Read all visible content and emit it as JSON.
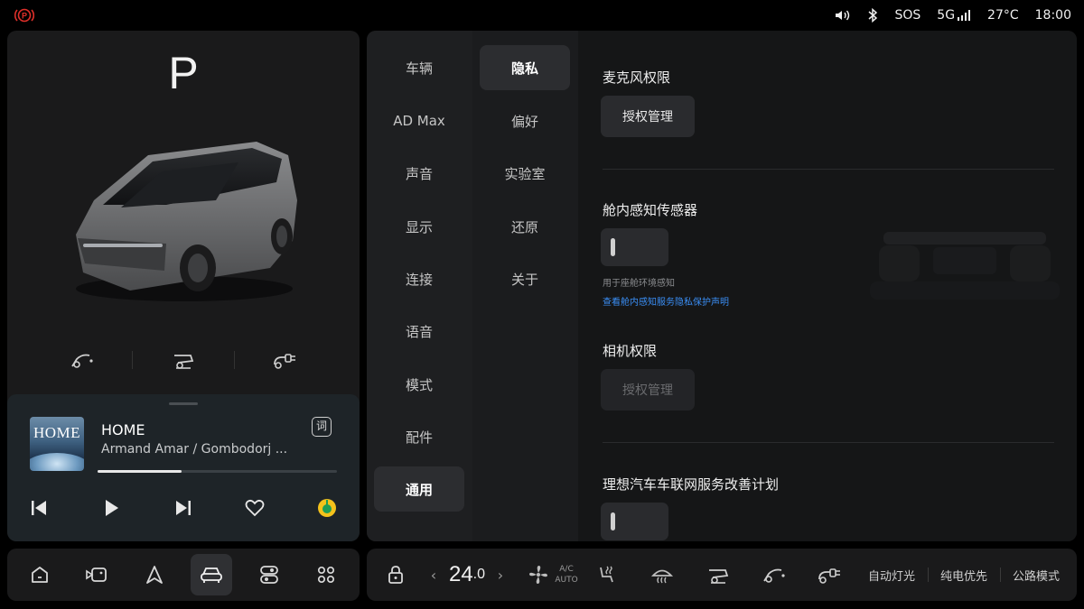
{
  "status_bar": {
    "park_icon": "parking-brake-icon",
    "sound_icon": "volume-icon",
    "bluetooth_icon": "bluetooth-icon",
    "sos": "SOS",
    "network": "5G",
    "temperature": "27°C",
    "time": "18:00"
  },
  "vehicle": {
    "gear": "P",
    "actions": [
      "front-trunk-icon",
      "rear-trunk-icon",
      "charge-port-icon"
    ]
  },
  "media": {
    "album_art_text": "HOME",
    "title": "HOME",
    "artist": "Armand Amar / Gombodorj ...",
    "lyrics_label": "词",
    "progress": 0.35
  },
  "settings": {
    "primary_nav": [
      {
        "label": "车辆"
      },
      {
        "label": "AD Max"
      },
      {
        "label": "声音"
      },
      {
        "label": "显示"
      },
      {
        "label": "连接"
      },
      {
        "label": "语音"
      },
      {
        "label": "模式"
      },
      {
        "label": "配件"
      },
      {
        "label": "通用",
        "active": true
      }
    ],
    "secondary_nav": [
      {
        "label": "隐私",
        "active": true
      },
      {
        "label": "偏好"
      },
      {
        "label": "实验室"
      },
      {
        "label": "还原"
      },
      {
        "label": "关于"
      }
    ],
    "sections": {
      "mic": {
        "title": "麦克风权限",
        "button": "授权管理"
      },
      "cabin_sensor": {
        "title": "舱内感知传感器",
        "toggle_on": false,
        "hint": "用于座舱环境感知",
        "link": "查看舱内感知服务隐私保护声明"
      },
      "camera": {
        "title": "相机权限",
        "button": "授权管理",
        "disabled": true
      },
      "iov": {
        "title": "理想汽车车联网服务改善计划",
        "toggle_on": false
      }
    }
  },
  "dock": {
    "items": [
      "home-icon",
      "camera-view-icon",
      "navigation-icon",
      "vehicle-icon",
      "toggle-controls-icon",
      "apps-grid-icon"
    ],
    "active_index": 3
  },
  "climate": {
    "lock_icon": "lock-icon",
    "temp_whole": "24",
    "temp_decimal": ".0",
    "temp_left_arrow": "‹",
    "temp_right_arrow": "›",
    "ac_line1": "A/C",
    "ac_line2": "AUTO",
    "auto_light": "自动灯光",
    "ev_priority": "纯电优先",
    "road_mode": "公路模式"
  }
}
